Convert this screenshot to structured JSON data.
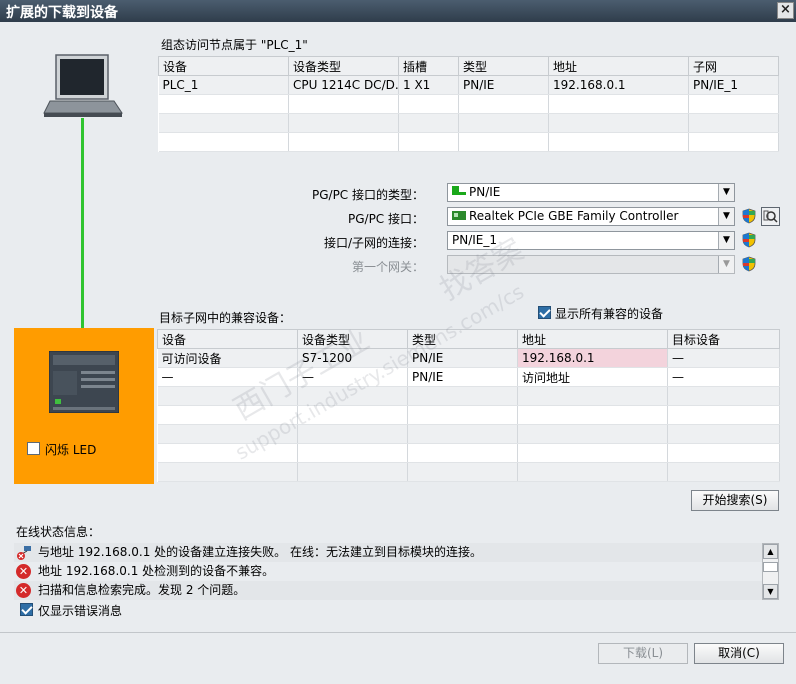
{
  "window": {
    "title": "扩展的下载到设备",
    "close": "×"
  },
  "config_section": {
    "title": "组态访问节点属于 \"PLC_1\"",
    "columns": [
      "设备",
      "设备类型",
      "插槽",
      "类型",
      "地址",
      "子网"
    ],
    "rows": [
      [
        "PLC_1",
        "CPU 1214C DC/D...",
        "1 X1",
        "PN/IE",
        "192.168.0.1",
        "PN/IE_1"
      ]
    ]
  },
  "interface": {
    "type_label": "PG/PC 接口的类型：",
    "type_value": "PN/IE",
    "iface_label": "PG/PC 接口：",
    "iface_value": "Realtek PCIe GBE Family Controller",
    "subnet_label": "接口/子网的连接：",
    "subnet_value": "PN/IE_1",
    "gateway_label": "第一个网关：",
    "gateway_value": ""
  },
  "target_section": {
    "title": "目标子网中的兼容设备：",
    "show_all_label": "显示所有兼容的设备",
    "show_all_checked": true,
    "columns": [
      "设备",
      "设备类型",
      "类型",
      "地址",
      "目标设备"
    ],
    "rows": [
      [
        "可访问设备",
        "S7-1200",
        "PN/IE",
        "192.168.0.1",
        "—"
      ],
      [
        "—",
        "—",
        "PN/IE",
        "访问地址",
        "—"
      ]
    ]
  },
  "flash_led": {
    "label": "闪烁 LED",
    "checked": false
  },
  "buttons": {
    "start_search": "开始搜索(S)",
    "download": "下载(L)",
    "cancel": "取消(C)"
  },
  "status": {
    "title": "在线状态信息：",
    "messages": [
      {
        "icon": "connection-error-icon",
        "text": "与地址 192.168.0.1 处的设备建立连接失败。 在线：无法建立到目标模块的连接。"
      },
      {
        "icon": "error-icon",
        "text": "地址 192.168.0.1 处检测到的设备不兼容。"
      },
      {
        "icon": "error-icon",
        "text": "扫描和信息检索完成。发现 2 个问题。"
      }
    ],
    "errors_only_label": "仅显示错误消息",
    "errors_only_checked": true
  },
  "watermark": [
    "西门子工业",
    "找答案",
    "support.industry.siemens.com/cs"
  ],
  "colors": {
    "highlight_orange": "#ff9c00",
    "green_link": "#2fc42f",
    "address_highlight": "#f3d3dc"
  }
}
